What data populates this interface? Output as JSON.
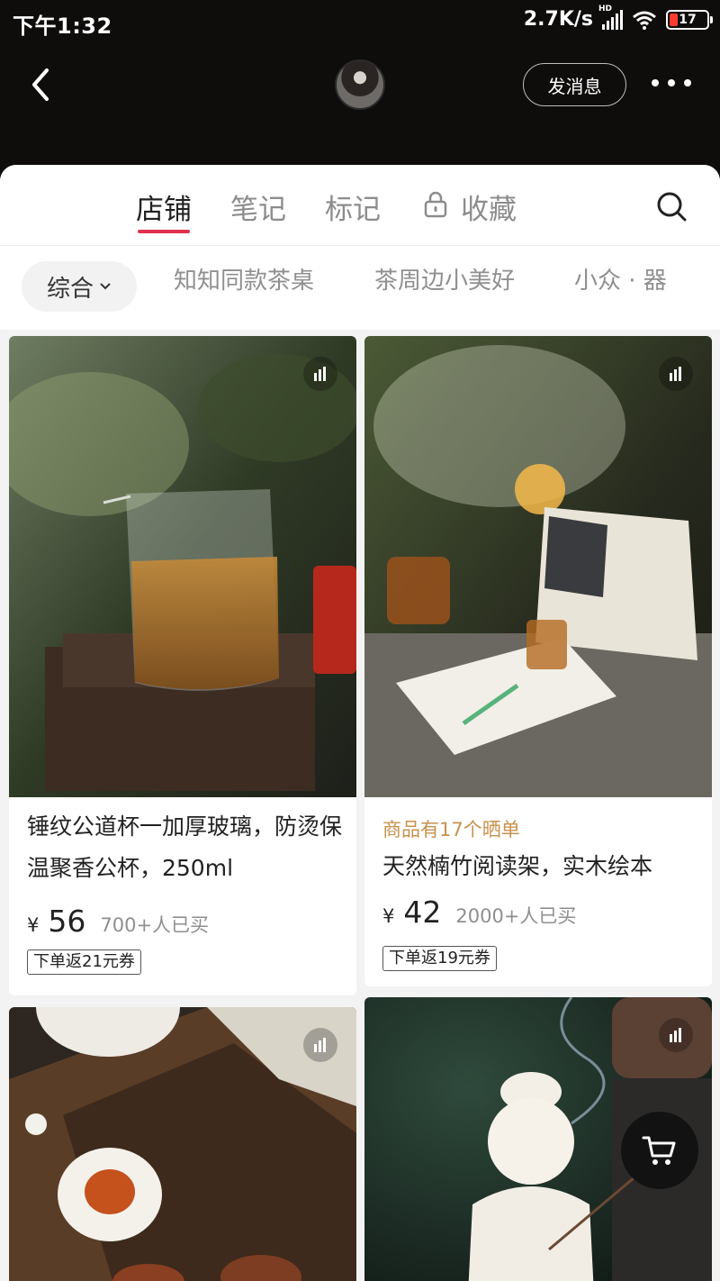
{
  "status_bar": {
    "time": "下午1:32",
    "net_speed": "2.7K/s",
    "signal_label": "HD",
    "battery_level": "17"
  },
  "header": {
    "message_button": "发消息"
  },
  "tabs": [
    {
      "label": "店铺",
      "active": true
    },
    {
      "label": "笔记",
      "active": false
    },
    {
      "label": "标记",
      "active": false
    },
    {
      "label": "收藏",
      "active": false,
      "locked": true
    }
  ],
  "filters": {
    "selected": "综合",
    "categories": [
      "知知同款茶桌",
      "茶周边小美好",
      "小众 · 器"
    ]
  },
  "products": [
    {
      "title": "锤纹公道杯一加厚玻璃，防烫保温聚香公杯，250ml",
      "currency": "¥",
      "price": "56",
      "sold": "700+人已买",
      "coupon": "下单返21元券"
    },
    {
      "tag": "商品有17个晒单",
      "title": "天然楠竹阅读架，实木绘本",
      "currency": "¥",
      "price": "42",
      "sold": "2000+人已买",
      "coupon": "下单返19元券"
    }
  ],
  "colors": {
    "accent": "#e0304e",
    "tag": "#c8914d",
    "header_bg": "#0f0d0c"
  }
}
